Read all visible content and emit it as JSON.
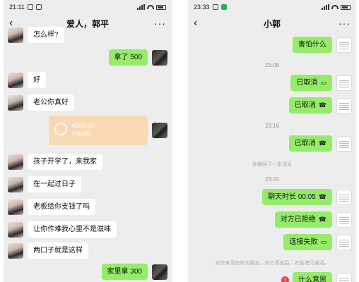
{
  "left": {
    "status": {
      "time": "21:11"
    },
    "title": "爱人，郭平",
    "messages": {
      "m1": "怎么样?",
      "m2": "拿了 500",
      "m3": "好",
      "m4": "老公你真好",
      "transfer_amount": "¥500.00",
      "transfer_status": "已被领取",
      "m5": "孩子开学了，来我家",
      "m6": "在一起过日子",
      "m7": "老板给你支钱了吗",
      "m8": "让你作难我心里不是滋味",
      "m9": "两口子就是这样",
      "m10": "家里拿 300"
    }
  },
  "right": {
    "status": {
      "time": "23:33"
    },
    "title": "小郭",
    "messages": {
      "r1": "害怕什么",
      "t1": "23:08",
      "r2": "已取消",
      "r3": "已取消",
      "t2": "23:16",
      "r4": "已取消",
      "notice1": "你撤回了一条消息",
      "t3": "23:24",
      "r5": "聊天时长 00:05",
      "r6": "对方已拒绝",
      "r7": "连接失败",
      "notice2": "对方未添加你为朋友。对方添加后，才能进行通话。",
      "r8": "什么意思"
    }
  },
  "icons": {
    "back": "‹",
    "more": "···",
    "video_call": "▭",
    "voice_call": "☎"
  },
  "colors": {
    "chat_bg": "#ededed",
    "bubble_self": "#95ec69",
    "bubble_other": "#ffffff",
    "transfer": "#f9d9b3"
  }
}
